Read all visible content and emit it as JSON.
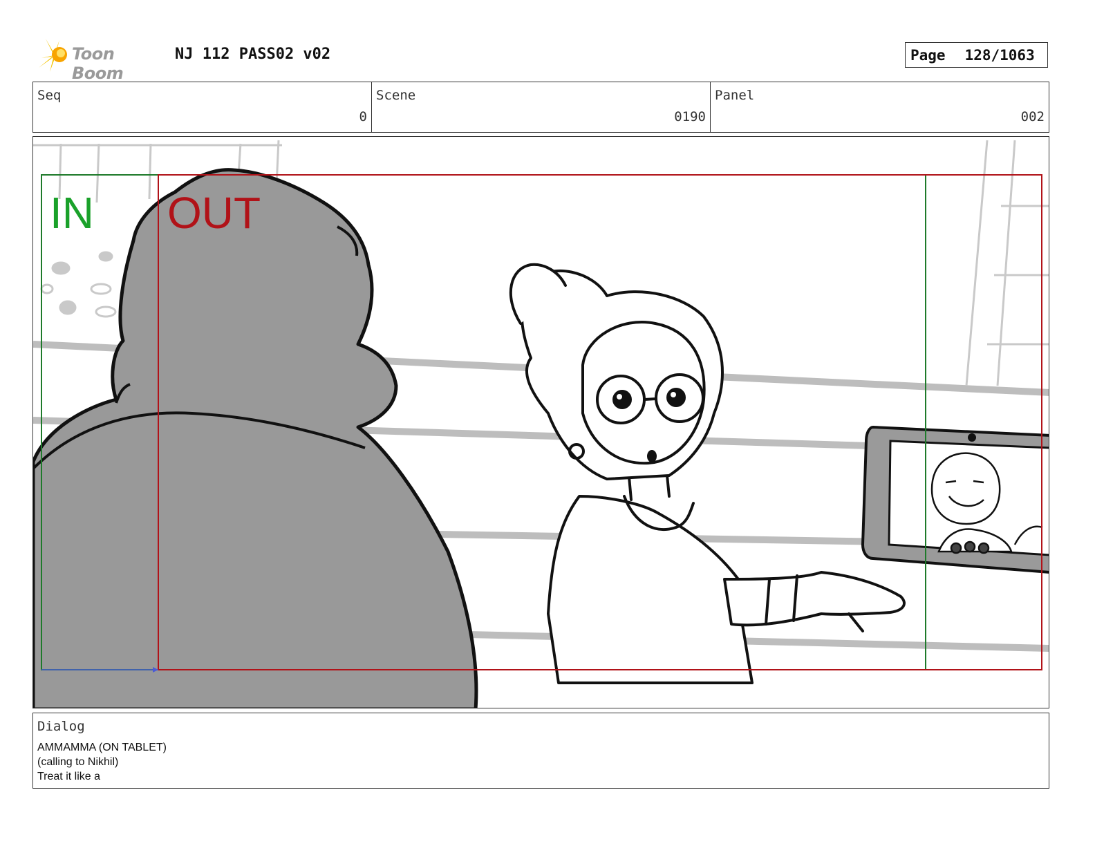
{
  "header": {
    "logo_text": "Toon Boom",
    "title": "NJ 112 PASS02 v02",
    "page_label": "Page",
    "page_value": "128/1063"
  },
  "meta": {
    "seq_label": "Seq",
    "seq_value": "0",
    "scene_label": "Scene",
    "scene_value": "0190",
    "panel_label": "Panel",
    "panel_value": "002"
  },
  "panel": {
    "in_label": "IN",
    "out_label": "OUT",
    "colors": {
      "in": "#1aa12a",
      "out": "#b11218",
      "silhouette": "#999999"
    }
  },
  "dialog": {
    "label": "Dialog",
    "lines": [
      "AMMAMMA (ON TABLET)",
      "(calling to Nikhil)",
      "Treat it like a"
    ]
  }
}
